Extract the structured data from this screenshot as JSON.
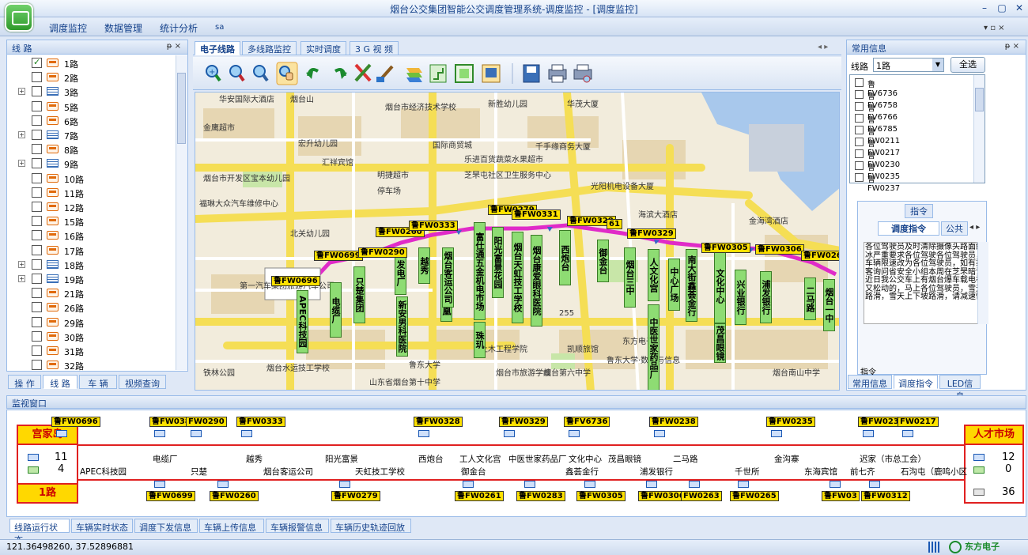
{
  "window": {
    "title": "烟台公交集团智能公交调度管理系统-调度监控 - [调度监控]",
    "min": "–",
    "max": "▢",
    "close": "✕"
  },
  "menu": {
    "items": [
      "调度监控",
      "数据管理",
      "统计分析",
      "sa"
    ],
    "sub_ctrl": "▾ ▫ ×"
  },
  "tree": {
    "title": "线  路",
    "pin": "ᵽ ×",
    "rows": [
      {
        "label": "1路",
        "icon": "bus",
        "checked": true,
        "expand": ""
      },
      {
        "label": "2路",
        "icon": "bus",
        "checked": false,
        "expand": ""
      },
      {
        "label": "3路",
        "icon": "grid",
        "checked": false,
        "expand": "+"
      },
      {
        "label": "5路",
        "icon": "bus",
        "checked": false,
        "expand": ""
      },
      {
        "label": "6路",
        "icon": "bus",
        "checked": false,
        "expand": ""
      },
      {
        "label": "7路",
        "icon": "grid",
        "checked": false,
        "expand": "+"
      },
      {
        "label": "8路",
        "icon": "bus",
        "checked": false,
        "expand": ""
      },
      {
        "label": "9路",
        "icon": "grid",
        "checked": false,
        "expand": "+"
      },
      {
        "label": "10路",
        "icon": "bus",
        "checked": false,
        "expand": ""
      },
      {
        "label": "11路",
        "icon": "bus",
        "checked": false,
        "expand": ""
      },
      {
        "label": "12路",
        "icon": "bus",
        "checked": false,
        "expand": ""
      },
      {
        "label": "15路",
        "icon": "bus",
        "checked": false,
        "expand": ""
      },
      {
        "label": "16路",
        "icon": "bus",
        "checked": false,
        "expand": ""
      },
      {
        "label": "17路",
        "icon": "bus",
        "checked": false,
        "expand": ""
      },
      {
        "label": "18路",
        "icon": "grid",
        "checked": false,
        "expand": "+"
      },
      {
        "label": "19路",
        "icon": "grid",
        "checked": false,
        "expand": "+"
      },
      {
        "label": "21路",
        "icon": "bus",
        "checked": false,
        "expand": ""
      },
      {
        "label": "26路",
        "icon": "bus",
        "checked": false,
        "expand": ""
      },
      {
        "label": "29路",
        "icon": "bus",
        "checked": false,
        "expand": ""
      },
      {
        "label": "30路",
        "icon": "bus",
        "checked": false,
        "expand": ""
      },
      {
        "label": "31路",
        "icon": "bus",
        "checked": false,
        "expand": ""
      },
      {
        "label": "32路",
        "icon": "bus",
        "checked": false,
        "expand": ""
      }
    ],
    "tabs": [
      "操  作",
      "线  路",
      "车  辆",
      "视频查询"
    ]
  },
  "center": {
    "tabs": [
      "电子线路",
      "多线路监控",
      "实时调度",
      "3 G 视 频"
    ],
    "nav": "◂ ▸"
  },
  "map": {
    "pois": [
      "华安国际大酒店",
      "烟台山",
      "烟台市经济技术学校",
      "新胜幼儿园",
      "华茂大厦",
      "金鹰超市",
      "宏升幼儿园",
      "国际商贸城",
      "千手缘商务大厦",
      "乐进百货蔬菜水果超市",
      "汇祥宾馆",
      "明捷超市",
      "芝罘屯社区卫生服务中心",
      "停车场",
      "烟台市开发区宝本幼儿园",
      "福琳大众汽车维修中心",
      "光阳机电设备大厦",
      "北关幼儿园",
      "海滨大酒店",
      "金海湾酒店",
      "第一汽车集团旅游汽车公司",
      "鲁东大学",
      "土木工程学院",
      "凯顺旅馆",
      "东方电子",
      "烟台第六中学",
      "烟台水运技工学校",
      "鲁东大学·数学与信息",
      "烟台市旅游学校",
      "山东省烟台第十中学",
      "255",
      "烟台南山中学",
      "铁林公园"
    ],
    "vehicles": [
      "鲁FW0696",
      "鲁FW0699",
      "鲁FW0290",
      "鲁FW0260",
      "鲁FW0333",
      "鲁FW0279",
      "鲁FW0331",
      "鲁FW0328",
      "61",
      "鲁FW0329",
      "鲁FW0305",
      "鲁FW0306",
      "鲁FW0263"
    ],
    "stops": [
      "APEC科技园",
      "电缆厂",
      "只楚集团",
      "发电厂",
      "越秀",
      "星汇凤凰",
      "新安男科医院",
      "烟台客运公司",
      "富仕通五金机电市场",
      "珠玑",
      "阳光富景花园",
      "烟台天虹技工学校",
      "烟台康爱眼科医院",
      "西炮台",
      "御金台",
      "烟台三中",
      "人文化宫",
      "中医世家药品厂",
      "中心广场",
      "南大街鑫荟金行",
      "文化中心",
      "茂昌眼镜",
      "兴业银行",
      "浦发银行",
      "二马路",
      "烟台一中"
    ]
  },
  "right": {
    "title": "常用信息",
    "pin": "ᵽ ×",
    "line_label": "线路",
    "line_value": "1路",
    "select_all": "全选",
    "vehicles": [
      "鲁FV6736",
      "鲁FV6758",
      "鲁FV6766",
      "鲁FV6785",
      "鲁FW0211",
      "鲁FW0217",
      "鲁FW0230",
      "鲁FW0235",
      "鲁FW0237"
    ],
    "cmd_header": "指令",
    "cmd_tabs": [
      "调度指令",
      "公共"
    ],
    "cmd_text": "各位驾驶员及时清除摄像头路面结冰严重要求各位驾驶各位驾驶员，车辆限速改为各位驾驶员，如有乘客询问省安全小组本周在芝罘暗访近日我公交车上有烟台爆车载电视又松动的，马上各位驾驶员，雪天路滑，雪天上下坡路滑，请减速慢",
    "cmd_footer": "指令",
    "bottom_tabs": [
      "常用信息",
      "调度指令",
      "LED信息"
    ]
  },
  "monitor": {
    "title": "监视窗口",
    "start": {
      "name": "宫家岛",
      "up": "11",
      "down": "4"
    },
    "line": "1路",
    "end": {
      "name": "人才市场",
      "up": "12",
      "down": "0",
      "other": "36"
    },
    "top_vehicles": [
      "鲁FW0696",
      "鲁FW0380",
      "FW0290",
      "鲁FW0333",
      "鲁FW0328",
      "鲁FW0329",
      "鲁FV6736",
      "鲁FW0238",
      "鲁FW0235",
      "鲁FW0230",
      "FW0217"
    ],
    "bottom_vehicles": [
      "鲁FW0699",
      "鲁FW0260",
      "鲁FW0279",
      "鲁FW0261",
      "鲁FW0283",
      "鲁FW0305",
      "鲁FW0306",
      "FW0263",
      "鲁FW0265",
      "鲁FW03",
      "鲁FW0312"
    ],
    "stops_row1": [
      "电缆厂",
      "越秀",
      "阳光富景",
      "西炮台",
      "工人文化宫",
      "中医世家药品厂",
      "文化中心",
      "茂昌眼镜",
      "二马路",
      "金沟寨",
      "迟家（市总工会）"
    ],
    "stops_row2": [
      "APEC科技园",
      "只楚",
      "烟台客运公司",
      "天虹技工学校",
      "御金台",
      "鑫荟金行",
      "浦发银行",
      "千世所",
      "东海宾馆",
      "前七齐",
      "石沟屯（鹿鸣小区"
    ]
  },
  "bottom_tabs": [
    "线路运行状态",
    "车辆实时状态",
    "调度下发信息",
    "车辆上传信息",
    "车辆报警信息",
    "车辆历史轨迹回放"
  ],
  "status": {
    "coords": "121.36498260, 37.52896881",
    "brand": "东方电子"
  }
}
